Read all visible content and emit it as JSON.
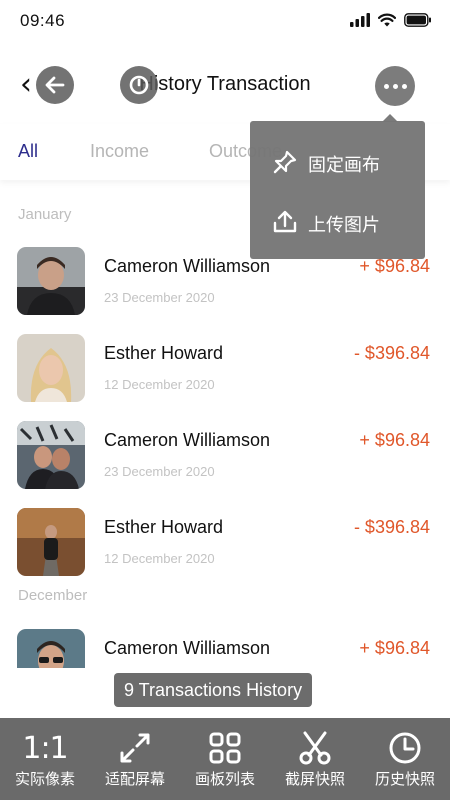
{
  "status_bar": {
    "time": "09:46"
  },
  "header": {
    "title": "History Transaction"
  },
  "tabs": [
    {
      "label": "All",
      "active": true
    },
    {
      "label": "Income",
      "active": false
    },
    {
      "label": "Outcome",
      "active": false
    }
  ],
  "groups": [
    {
      "month": "January"
    },
    {
      "month": "December"
    }
  ],
  "transactions": [
    {
      "name": "Cameron Williamson",
      "date": "23 December 2020",
      "amount": "+ $96.84"
    },
    {
      "name": "Esther Howard",
      "date": "12 December 2020",
      "amount": "- $396.84"
    },
    {
      "name": "Cameron Williamson",
      "date": "23 December 2020",
      "amount": "+ $96.84"
    },
    {
      "name": "Esther Howard",
      "date": "12 December 2020",
      "amount": "- $396.84"
    },
    {
      "name": "Cameron Williamson",
      "date": "",
      "amount": "+ $96.84"
    }
  ],
  "menu": {
    "items": [
      {
        "label": "固定画布",
        "icon": "pin-icon"
      },
      {
        "label": "上传图片",
        "icon": "upload-icon"
      }
    ]
  },
  "toast": {
    "text": "9 Transactions History"
  },
  "toolbar": {
    "items": [
      {
        "label": "实际像素",
        "icon_text": "1:1",
        "icon": "actual-size-icon"
      },
      {
        "label": "适配屏幕",
        "icon": "fit-screen-icon"
      },
      {
        "label": "画板列表",
        "icon": "artboard-grid-icon"
      },
      {
        "label": "截屏快照",
        "icon": "scissors-icon"
      },
      {
        "label": "历史快照",
        "icon": "clock-icon"
      }
    ]
  },
  "colors": {
    "accent_tab": "#2d2d8c",
    "amount": "#e0572a",
    "toolbar_bg": "#6a6a6a",
    "overlay": "#767676"
  }
}
